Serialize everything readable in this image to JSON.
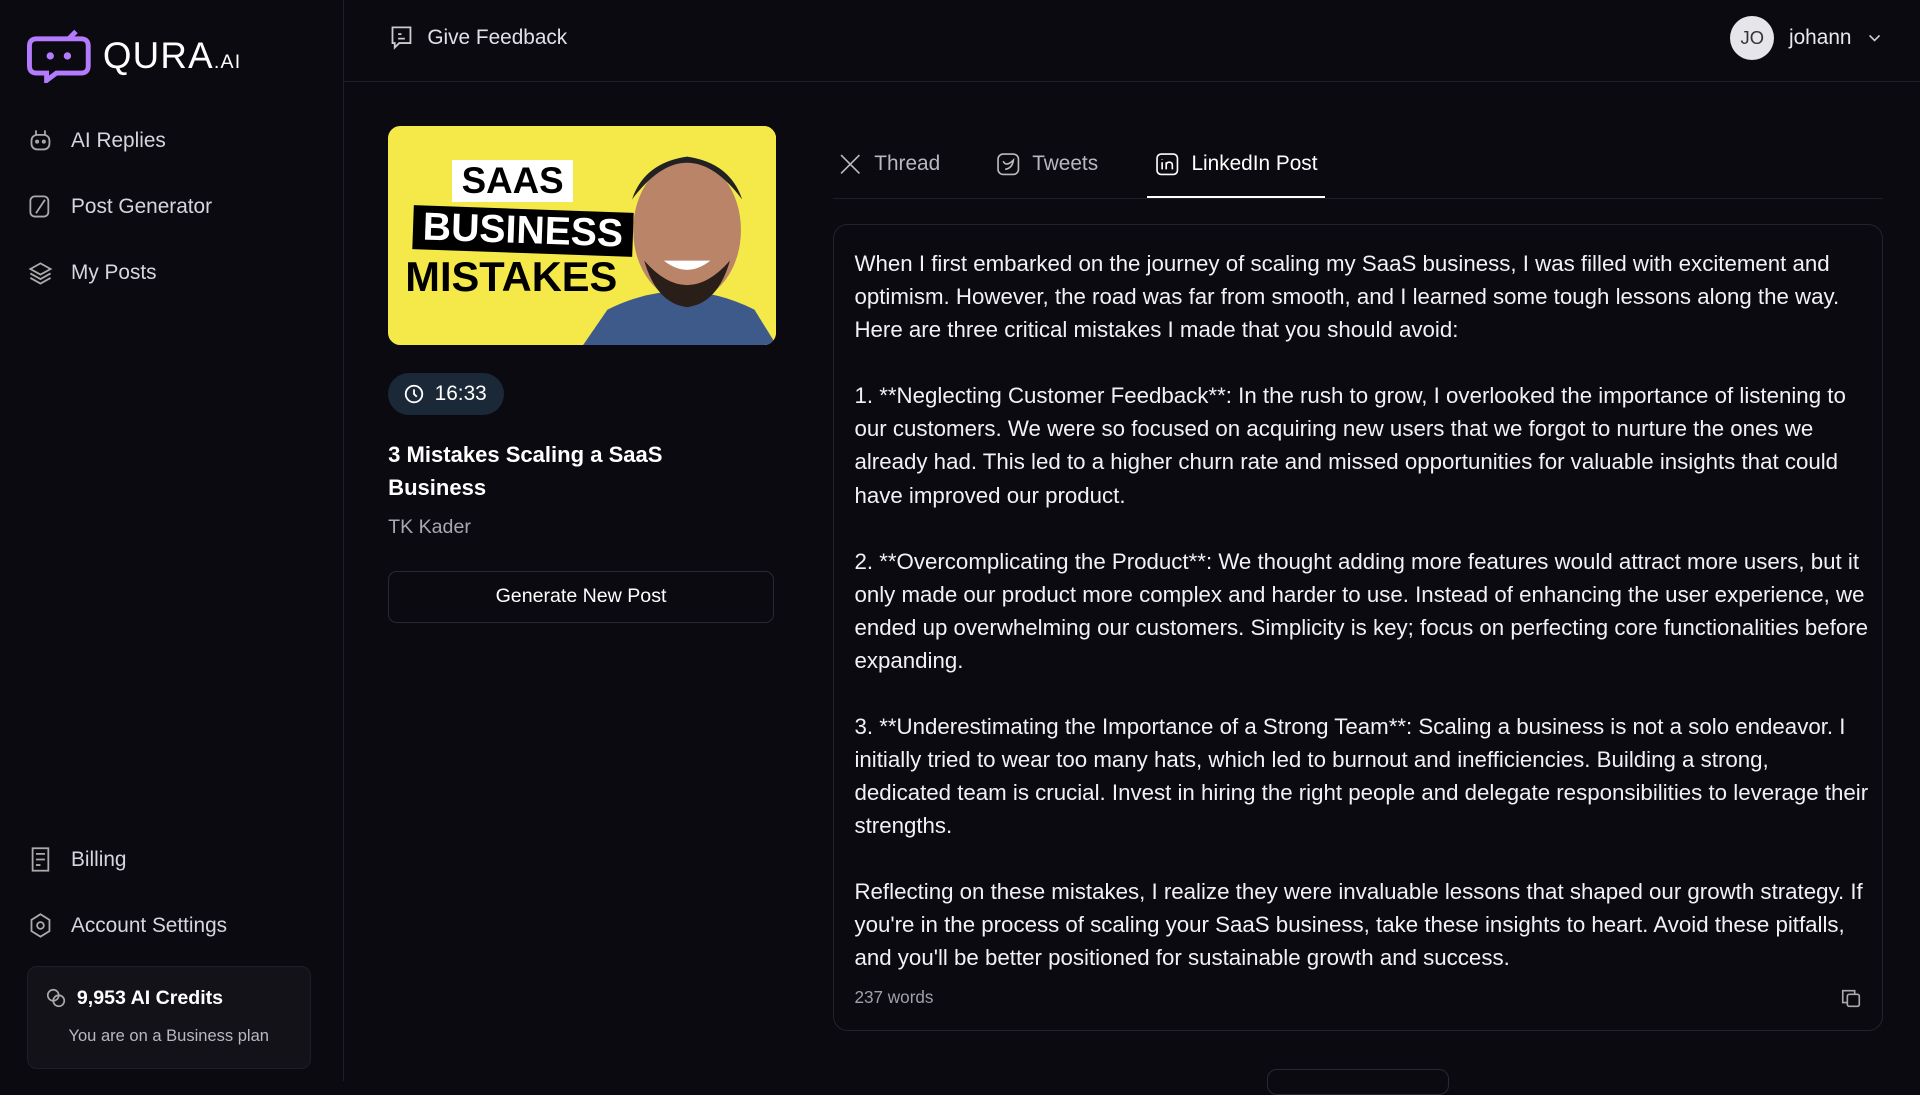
{
  "brand": {
    "name": "QURA",
    "suffix": ".AI",
    "color": "#b57bff"
  },
  "sidebar": {
    "items": [
      {
        "label": "AI Replies",
        "icon": "robot-icon"
      },
      {
        "label": "Post Generator",
        "icon": "feather-icon"
      },
      {
        "label": "My Posts",
        "icon": "layers-icon"
      }
    ],
    "bottom_items": [
      {
        "label": "Billing",
        "icon": "receipt-icon"
      },
      {
        "label": "Account Settings",
        "icon": "gear-icon"
      }
    ],
    "credits": {
      "amount": "9,953 AI Credits",
      "plan": "You are on a Business plan"
    }
  },
  "topbar": {
    "feedback": "Give Feedback",
    "user": {
      "initials": "JO",
      "name": "johann"
    }
  },
  "video": {
    "thumbnail": {
      "line1": "SAAS",
      "line2": "BUSINESS",
      "line3": "MISTAKES"
    },
    "duration": "16:33",
    "title": "3 Mistakes Scaling a SaaS Business",
    "author": "TK Kader",
    "generate_label": "Generate New Post"
  },
  "tabs": [
    {
      "label": "Thread"
    },
    {
      "label": "Tweets"
    },
    {
      "label": "LinkedIn Post",
      "active": true
    }
  ],
  "post": {
    "paragraphs": [
      "When I first embarked on the journey of scaling my SaaS business, I was filled with excitement and optimism. However, the road was far from smooth, and I learned some tough lessons along the way. Here are three critical mistakes I made that you should avoid:",
      "1. **Neglecting Customer Feedback**: In the rush to grow, I overlooked the importance of listening to our customers. We were so focused on acquiring new users that we forgot to nurture the ones we already had. This led to a higher churn rate and missed opportunities for valuable insights that could have improved our product.",
      "2. **Overcomplicating the Product**: We thought adding more features would attract more users, but it only made our product more complex and harder to use. Instead of enhancing the user experience, we ended up overwhelming our customers. Simplicity is key; focus on perfecting core functionalities before expanding.",
      "3. **Underestimating the Importance of a Strong Team**: Scaling a business is not a solo endeavor. I initially tried to wear too many hats, which led to burnout and inefficiencies. Building a strong, dedicated team is crucial. Invest in hiring the right people and delegate responsibilities to leverage their strengths.",
      "Reflecting on these mistakes, I realize they were invaluable lessons that shaped our growth strategy. If you're in the process of scaling your SaaS business, take these insights to heart. Avoid these pitfalls, and you'll be better positioned for sustainable growth and success."
    ],
    "word_count": "237 words"
  }
}
